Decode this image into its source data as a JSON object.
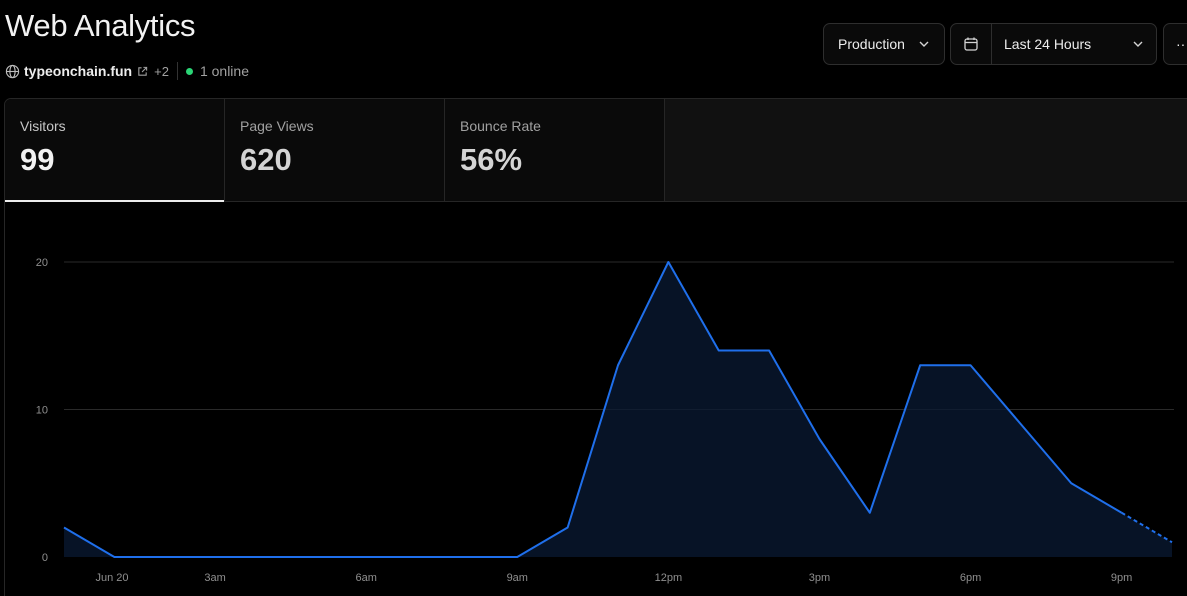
{
  "header": {
    "title": "Web Analytics",
    "domain": "typeonchain.fun",
    "domain_extra": "+2",
    "online": "1 online"
  },
  "controls": {
    "environment": "Production",
    "range": "Last 24 Hours",
    "more": "···"
  },
  "metrics": [
    {
      "label": "Visitors",
      "value": "99"
    },
    {
      "label": "Page Views",
      "value": "620"
    },
    {
      "label": "Bounce Rate",
      "value": "56%"
    }
  ],
  "colors": {
    "accent": "#1f6feb",
    "online_dot": "#2bd576"
  },
  "chart_data": {
    "type": "area",
    "x": [
      "Jun 20 00:00",
      "01:00",
      "02:00",
      "03:00",
      "04:00",
      "05:00",
      "06:00",
      "07:00",
      "08:00",
      "09:00",
      "10:00",
      "11:00",
      "12:00",
      "13:00",
      "14:00",
      "15:00",
      "16:00",
      "17:00",
      "18:00",
      "19:00",
      "20:00",
      "21:00",
      "22:00"
    ],
    "x_tick_labels": [
      "Jun 20",
      "3am",
      "6am",
      "9am",
      "12pm",
      "3pm",
      "6pm",
      "9pm"
    ],
    "series": [
      {
        "values": [
          2,
          0,
          0,
          0,
          0,
          0,
          0,
          0,
          0,
          0,
          2,
          13,
          20,
          14,
          14,
          8,
          3,
          13,
          13,
          9,
          5,
          3,
          1
        ]
      }
    ],
    "partial_from_index": 21,
    "y_ticks": [
      0,
      10,
      20
    ],
    "ylim": [
      0,
      20
    ],
    "grid": true,
    "legend": "none"
  }
}
